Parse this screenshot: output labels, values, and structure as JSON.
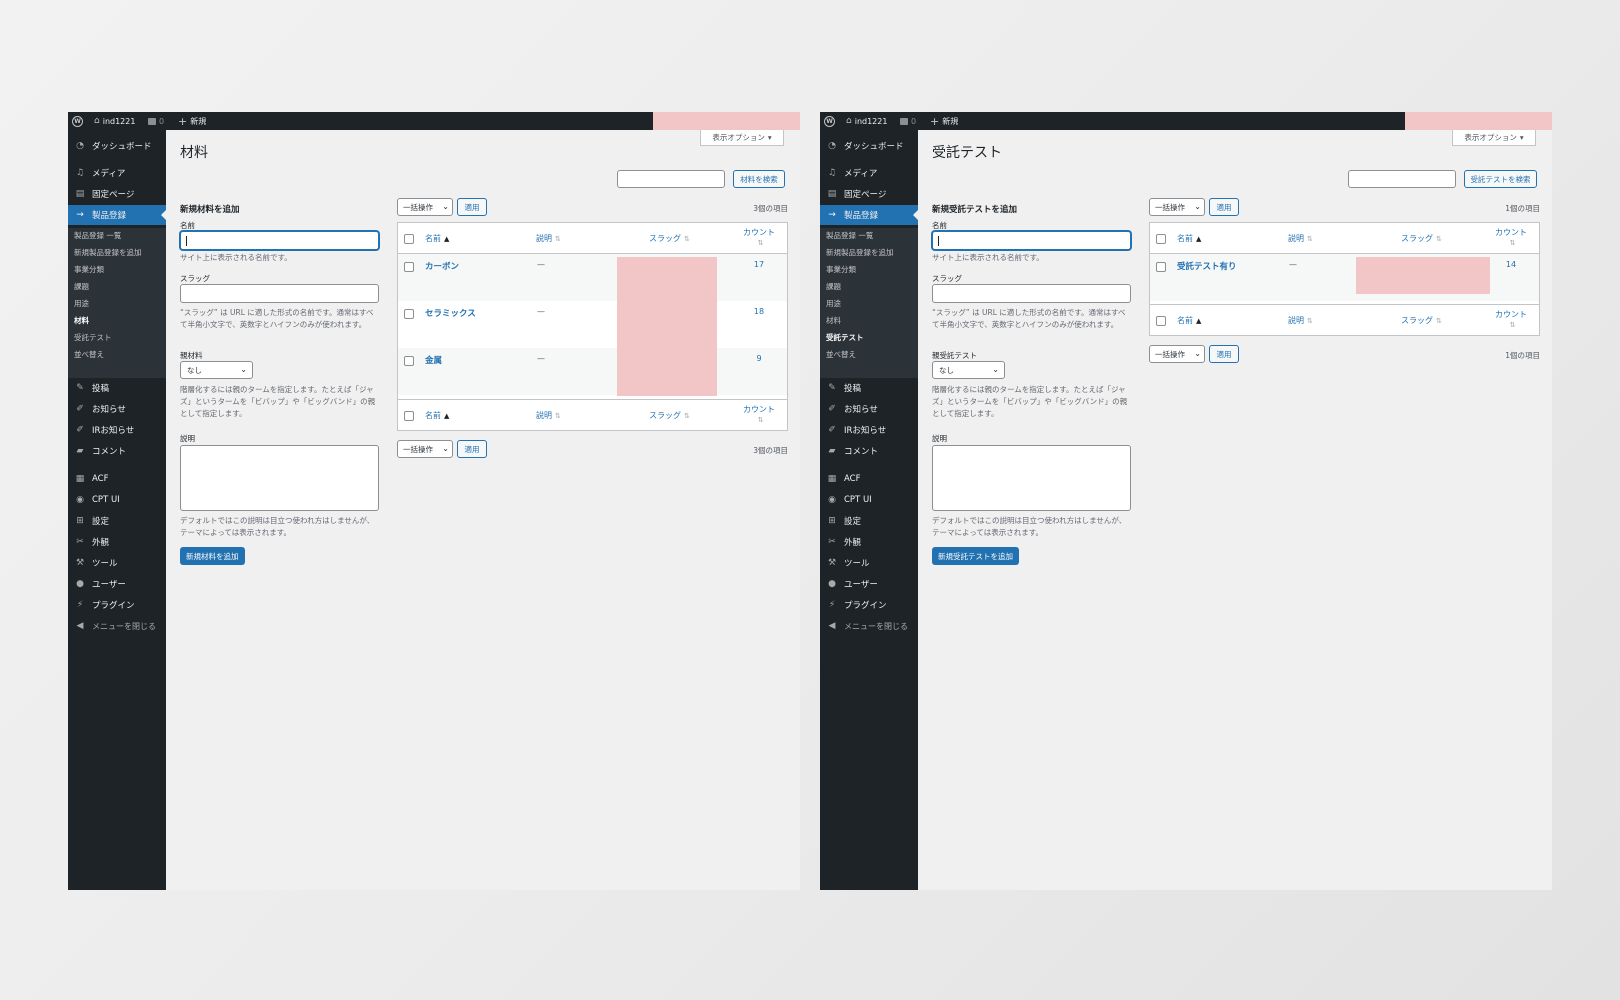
{
  "colors": {
    "admin_bar": "#1d2327",
    "sidebar": "#1d2327",
    "accent": "#2271b1",
    "content_bg": "#f0f0f1",
    "redaction": "#f2c6c6"
  },
  "admin_bar": {
    "site_name": "ind1221",
    "comments_count": "0",
    "new_label": "新規"
  },
  "sidebar": {
    "items": [
      {
        "label": "ダッシュボード",
        "icon": "dashboard-icon"
      },
      {
        "label": "メディア",
        "icon": "media-icon"
      },
      {
        "label": "固定ページ",
        "icon": "page-icon"
      },
      {
        "label": "製品登録",
        "icon": "arrow-right-icon"
      },
      {
        "label": "投稿",
        "icon": "pin-icon"
      },
      {
        "label": "お知らせ",
        "icon": "pen-icon"
      },
      {
        "label": "IRお知らせ",
        "icon": "pen-icon"
      },
      {
        "label": "コメント",
        "icon": "comment-icon"
      },
      {
        "label": "ACF",
        "icon": "acf-icon"
      },
      {
        "label": "CPT UI",
        "icon": "cptui-icon"
      },
      {
        "label": "設定",
        "icon": "settings-icon"
      },
      {
        "label": "外観",
        "icon": "appearance-icon"
      },
      {
        "label": "ツール",
        "icon": "wrench-icon"
      },
      {
        "label": "ユーザー",
        "icon": "user-icon"
      },
      {
        "label": "プラグイン",
        "icon": "plugin-icon"
      }
    ],
    "submenu": [
      "製品登録 一覧",
      "新規製品登録を追加",
      "事業分類",
      "課題",
      "用途",
      "材料",
      "受託テスト",
      "並べ替え"
    ],
    "collapse_label": "メニューを閉じる"
  },
  "common": {
    "screen_options": "表示オプション",
    "name_label": "名前",
    "name_help": "サイト上に表示される名前です。",
    "slug_label": "スラッグ",
    "slug_help": "“スラッグ” は URL に適した形式の名前です。通常はすべて半角小文字で、英数字とハイフンのみが使われます。",
    "parent_value": "なし",
    "parent_help": "階層化するには親のタームを指定します。たとえば「ジャズ」というタームを「ビバップ」や「ビッグバンド」の親として指定します。",
    "desc_label": "説明",
    "desc_help": "デフォルトではこの説明は目立つ使われ方はしませんが、テーマによっては表示されます。",
    "bulk_actions": "一括操作",
    "apply": "適用",
    "col_name": "名前",
    "col_desc": "説明",
    "col_slug": "スラッグ",
    "col_count": "カウント"
  },
  "left": {
    "page_title": "材料",
    "search_button": "材料を検索",
    "form_title": "新規材料を追加",
    "parent_label": "親材料",
    "submit": "新規材料を追加",
    "items_count": "3個の項目",
    "active_submenu": "材料",
    "rows": [
      {
        "name": "カーボン",
        "desc": "—",
        "count": "17"
      },
      {
        "name": "セラミックス",
        "desc": "—",
        "count": "18"
      },
      {
        "name": "金属",
        "desc": "—",
        "count": "9"
      }
    ]
  },
  "right": {
    "page_title": "受託テスト",
    "search_button": "受託テストを検索",
    "form_title": "新規受託テストを追加",
    "parent_label": "親受託テスト",
    "submit": "新規受託テストを追加",
    "items_count": "1個の項目",
    "active_submenu": "受託テスト",
    "rows": [
      {
        "name": "受託テスト有り",
        "desc": "—",
        "count": "14"
      }
    ]
  }
}
